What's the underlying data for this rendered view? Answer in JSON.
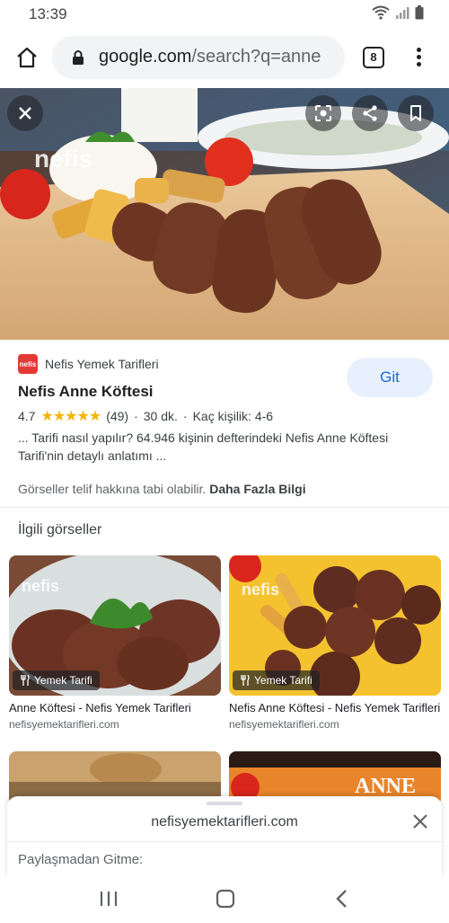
{
  "status": {
    "time": "13:39"
  },
  "browser": {
    "url_host": "google.com",
    "url_rest": "/search?q=anne",
    "tab_count": "8"
  },
  "result": {
    "source": "Nefis Yemek Tarifleri",
    "favicon_text": "nefis",
    "visit_label": "Git",
    "title": "Nefis Anne Köftesi",
    "rating": "4.7",
    "stars": "★★★★★",
    "reviews": "(49)",
    "time": "30 dk.",
    "servings": "Kaç kişilik: 4-6",
    "description": "... Tarifi nasıl yapılır? 64.946 kişinin defterindeki Nefis Anne Köftesi Tarifi'nin detaylı anlatımı ...",
    "copyright_text": "Görseller telif hakkına tabi olabilir.",
    "more_info": "Daha Fazla Bilgi"
  },
  "related": {
    "heading": "İlgili görseller",
    "cards": [
      {
        "badge": "Yemek Tarifi",
        "title": "Anne Köftesi - Nefis Yemek Tarifleri",
        "domain": "nefisyemektarifleri.com"
      },
      {
        "badge": "Yemek Tarifi",
        "title": "Nefis Anne Köftesi - Nefis Yemek Tarifleri",
        "domain": "nefisyemektarifleri.com"
      }
    ]
  },
  "image_watermark": "nefis",
  "bottom_card_text": "ANNE",
  "sheet": {
    "domain": "nefisyemektarifleri.com",
    "subtitle": "Paylaşmadan Gitme:"
  },
  "icons": [
    "wifi-icon",
    "signal-icon",
    "battery-icon",
    "home-icon",
    "lock-icon",
    "tabs-icon",
    "more-vert-icon",
    "close-icon",
    "lens-icon",
    "share-icon",
    "bookmark-icon",
    "cutlery-icon",
    "recents-icon",
    "home-nav-icon",
    "back-icon"
  ],
  "colors": {
    "accent": "#1967d2",
    "star": "#f4b400",
    "favicon": "#e53935"
  }
}
